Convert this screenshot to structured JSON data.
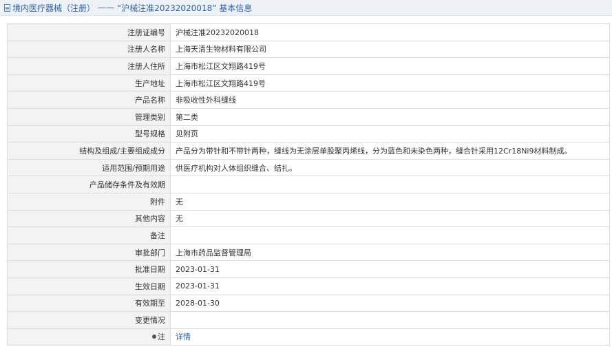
{
  "header": {
    "category": "境内医疗器械（注册）",
    "separator": "——",
    "subtitle": "“沪械注准20232020018” 基本信息"
  },
  "rows": [
    {
      "label": "注册证编号",
      "value": "沪械注准20232020018"
    },
    {
      "label": "注册人名称",
      "value": "上海天清生物材料有限公司"
    },
    {
      "label": "注册人住所",
      "value": "上海市松江区文翔路419号"
    },
    {
      "label": "生产地址",
      "value": "上海市松江区文翔路419号"
    },
    {
      "label": "产品名称",
      "value": "非吸收性外科缝线"
    },
    {
      "label": "管理类别",
      "value": "第二类"
    },
    {
      "label": "型号规格",
      "value": "见附页"
    },
    {
      "label": "结构及组成/主要组成成分",
      "value": "产品分为带针和不带针两种，缝线为无涂层单股聚丙烯线，分为蓝色和未染色两种，缝合针采用12Cr18Ni9材料制成。"
    },
    {
      "label": "适用范围/预期用途",
      "value": "供医疗机构对人体组织缝合、结扎。"
    },
    {
      "label": "产品储存条件及有效期",
      "value": ""
    },
    {
      "label": "附件",
      "value": "无"
    },
    {
      "label": "其他内容",
      "value": "无"
    },
    {
      "label": "备注",
      "value": ""
    },
    {
      "label": "审批部门",
      "value": "上海市药品监督管理局"
    },
    {
      "label": "批准日期",
      "value": "2023-01-31"
    },
    {
      "label": "生效日期",
      "value": "2023-01-31"
    },
    {
      "label": "有效期至",
      "value": "2028-01-30"
    },
    {
      "label": "变更情况",
      "value": ""
    }
  ],
  "note_row": {
    "label": "注",
    "link_text": "详情"
  }
}
